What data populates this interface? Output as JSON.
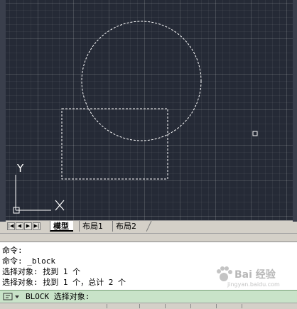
{
  "layout_tabs": [
    {
      "label": "模型",
      "active": true
    },
    {
      "label": "布局1",
      "active": false
    },
    {
      "label": "布局2",
      "active": false
    }
  ],
  "nav_buttons": [
    "first-icon",
    "prev-icon",
    "next-icon",
    "last-icon"
  ],
  "ucs": {
    "y_label": "Y"
  },
  "command_history": [
    "命令:",
    "命令: _block",
    "选择对象: 找到 1 个",
    "选择对象: 找到 1 个，总计 2 个"
  ],
  "command_prompt": "BLOCK 选择对象:",
  "watermark": {
    "text": "Bai 经验",
    "url": "jingyan.baidu.com"
  },
  "colors": {
    "viewport_bg": "#252a36",
    "entity": "#ffffff",
    "command_input_bg": "#c9e3c9"
  }
}
